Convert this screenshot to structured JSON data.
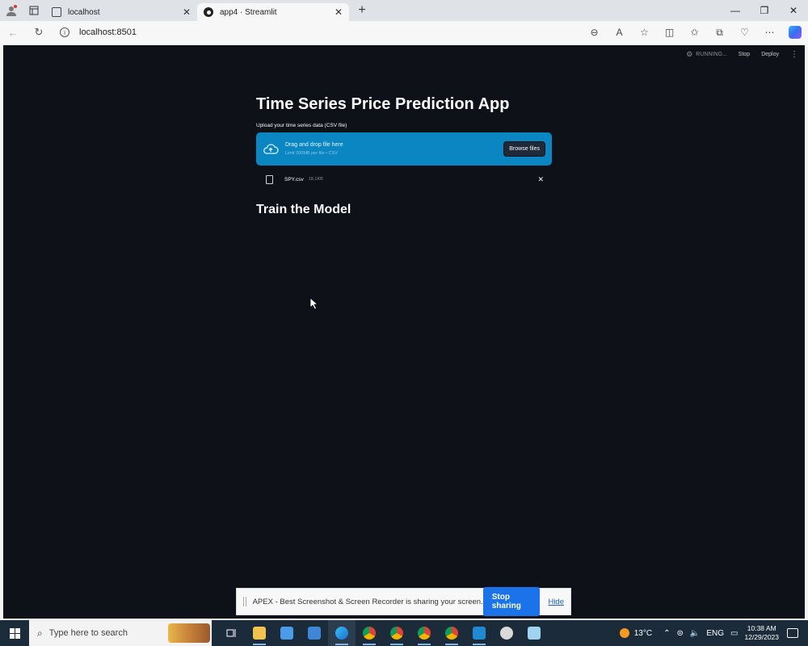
{
  "browser": {
    "tabs": [
      {
        "label": "localhost",
        "active": false
      },
      {
        "label": "app4 · Streamlit",
        "active": true
      }
    ],
    "new_tab_icon": "plus-icon",
    "address": "localhost:8501",
    "window_controls": [
      "minimize-icon",
      "restore-icon",
      "close-icon"
    ]
  },
  "app": {
    "status": "RUNNING...",
    "stop_label": "Stop",
    "deploy_label": "Deploy",
    "title": "Time Series Price Prediction App",
    "upload_label": "Upload your time series data (CSV file)",
    "dropzone": {
      "main": "Drag and drop file here",
      "sub": "Limit 200MB per file • CSV",
      "browse_label": "Browse files",
      "color": "#0a86c2"
    },
    "file": {
      "name": "SPY.csv",
      "size": "18.1KB"
    },
    "section_title": "Train the Model",
    "background": "#0e1117"
  },
  "sharebar": {
    "text": "APEX - Best Screenshot & Screen Recorder is sharing your screen.",
    "stop_label": "Stop sharing",
    "hide_label": "Hide"
  },
  "taskbar": {
    "search_placeholder": "Type here to search",
    "weather": "13°C",
    "time": "10:38 AM",
    "date": "12/29/2023",
    "tray_language": "ENG"
  }
}
